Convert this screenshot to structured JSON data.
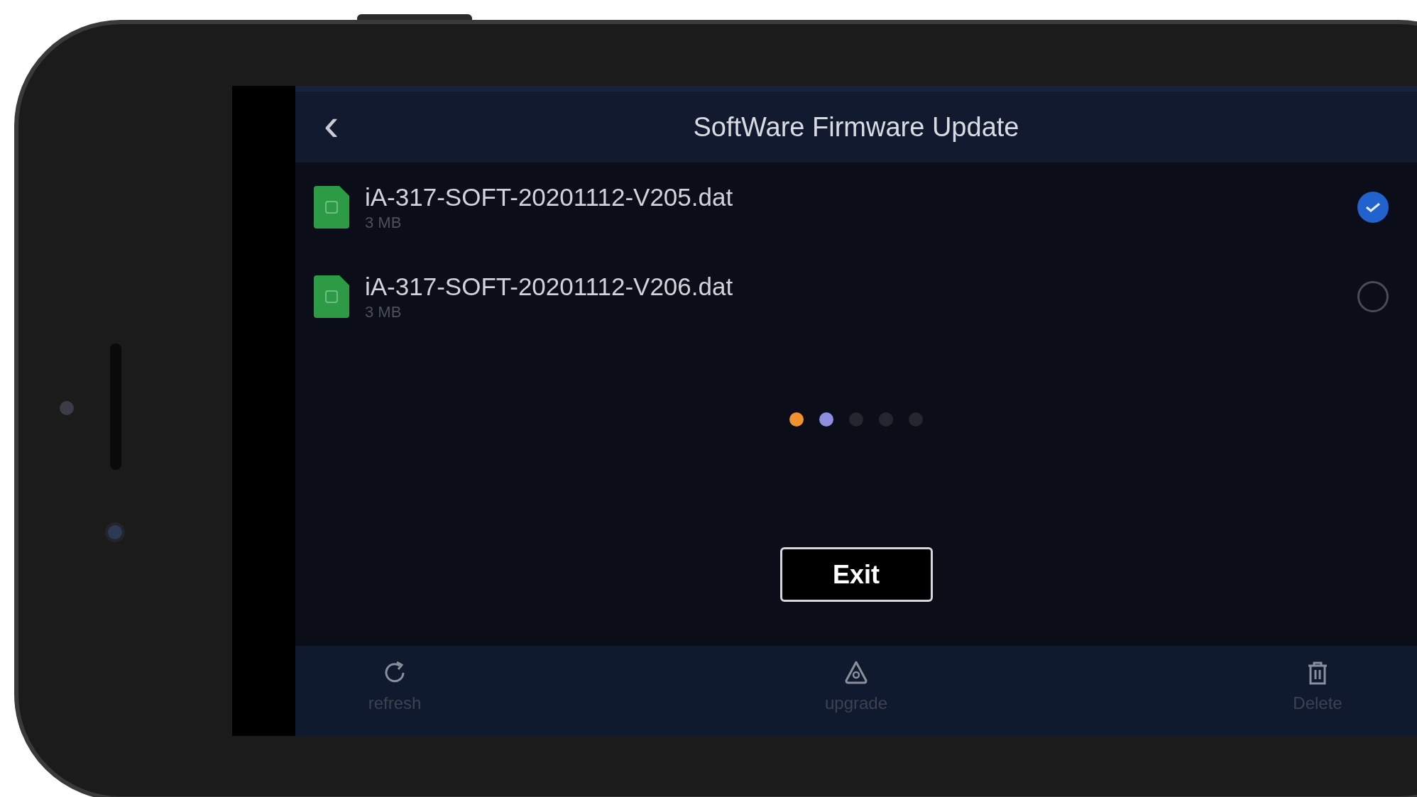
{
  "header": {
    "back_icon": "‹",
    "title": "SoftWare Firmware Update"
  },
  "files": [
    {
      "name": "iA-317-SOFT-20201112-V205.dat",
      "size": "3 MB",
      "selected": true
    },
    {
      "name": "iA-317-SOFT-20201112-V206.dat",
      "size": "3 MB",
      "selected": false
    }
  ],
  "loading_dots": [
    {
      "color": "#f0922e"
    },
    {
      "color": "#8d8ee0"
    },
    {
      "color": "#25262e"
    },
    {
      "color": "#25262e"
    },
    {
      "color": "#25262e"
    }
  ],
  "exit_button": "Exit",
  "toolbar": [
    {
      "kind": "refresh",
      "label": "refresh"
    },
    {
      "kind": "upgrade",
      "label": "upgrade"
    },
    {
      "kind": "delete",
      "label": "Delete"
    }
  ]
}
